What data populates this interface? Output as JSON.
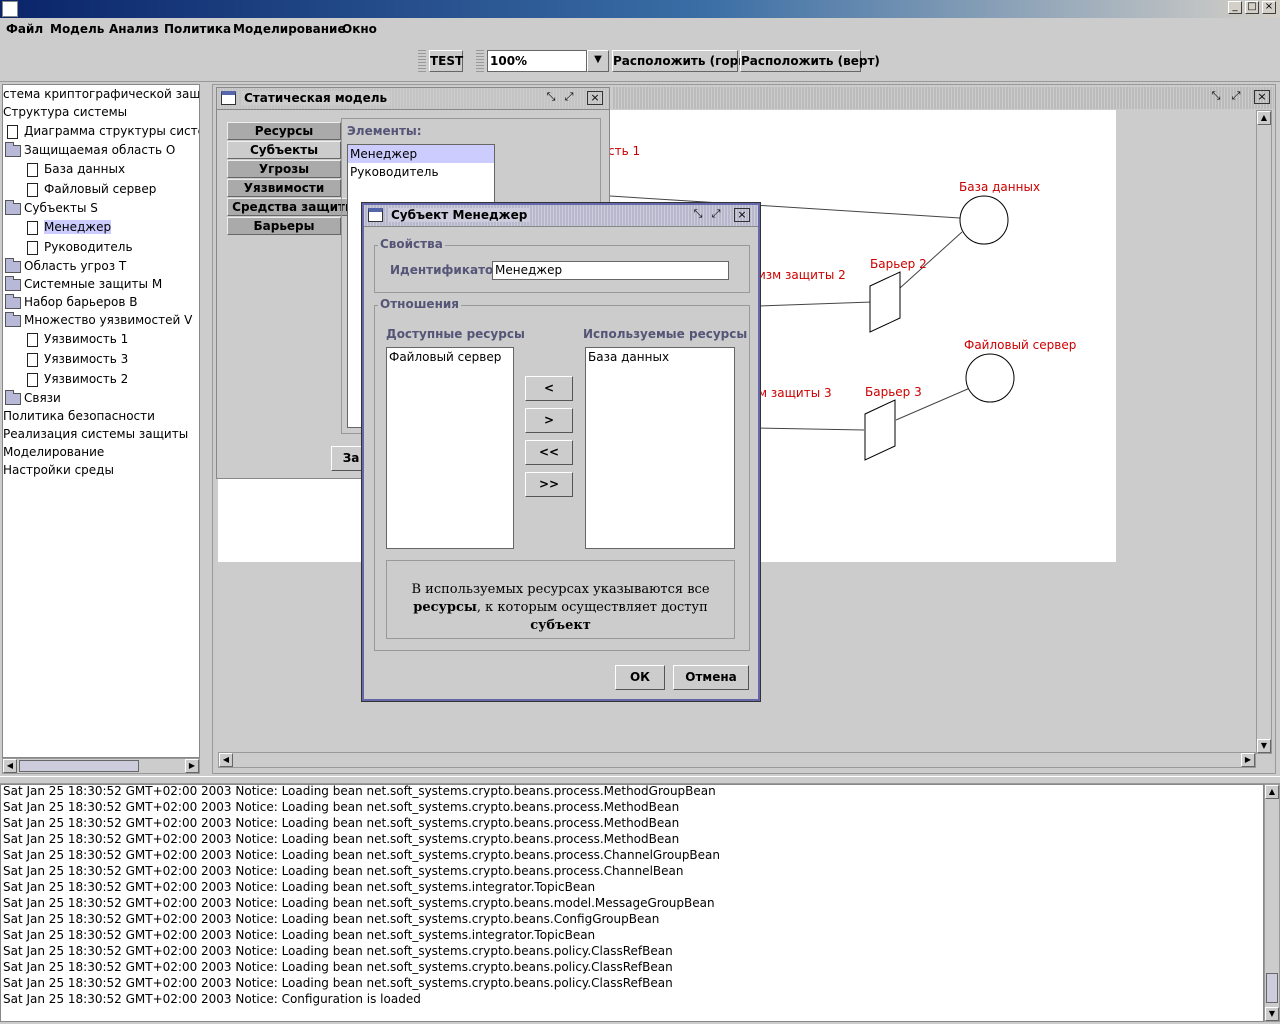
{
  "menu": [
    "Файл",
    "Модель",
    "Анализ",
    "Политика",
    "Моделирование",
    "Окно"
  ],
  "toolbar": {
    "test_label": "TEST",
    "zoom_value": "100%",
    "arrange_h_label": "Расположить (гориз)",
    "arrange_v_label": "Расположить (верт)"
  },
  "tree": [
    "стема криптографической защиты",
    "Структура системы",
    "Диаграмма структуры системы",
    "Защищаемая область O",
    "База данных",
    "Файловый сервер",
    "Субъекты S",
    "Менеджер",
    "Руководитель",
    "Область угроз T",
    "Системные защиты M",
    "Набор барьеров B",
    "Множество уязвимостей V",
    "Уязвимость 1",
    "Уязвимость 3",
    "Уязвимость 2",
    "Связи",
    "Политика безопасности",
    "Реализация системы защиты",
    "Моделирование",
    "Настройки среды"
  ],
  "static_model": {
    "title": "Статическая модель",
    "tabs": [
      "Ресурсы",
      "Субъекты",
      "Угрозы",
      "Уязвимости",
      "Средства защиты",
      "Барьеры"
    ],
    "elements_label": "Элементы:",
    "elements": [
      "Менеджер",
      "Руководитель"
    ],
    "partial_button": "За"
  },
  "diagram": {
    "labels": {
      "area1": "сть 1",
      "db": "База данных",
      "mech2": "изм защиты 2",
      "barrier2": "Барьер 2",
      "fileserver": "Файловый сервер",
      "mech3": "м защиты 3",
      "barrier3": "Барьер 3"
    }
  },
  "dialog": {
    "title": "Субъект Менеджер",
    "props_legend": "Свойства",
    "id_label": "Идентификатор:",
    "id_value": "Менеджер",
    "rel_legend": "Отношения",
    "available_label": "Доступные ресурсы",
    "used_label": "Используемые ресурсы",
    "available": [
      "Файловый сервер"
    ],
    "used": [
      "База данных"
    ],
    "btn_lt": "<",
    "btn_gt": ">",
    "btn_llt": "<<",
    "btn_ggt": ">>",
    "hint_a": "В используемых ресурсах указываются все ",
    "hint_b": "ресурсы",
    "hint_c": ", к которым осуществляет доступ ",
    "hint_d": "субъект",
    "ok": "ОК",
    "cancel": "Отмена"
  },
  "log": [
    "Sat Jan 25 18:30:52 GMT+02:00 2003 Notice: Loading bean net.soft_systems.crypto.beans.process.MethodGroupBean",
    "Sat Jan 25 18:30:52 GMT+02:00 2003 Notice: Loading bean net.soft_systems.crypto.beans.process.MethodBean",
    "Sat Jan 25 18:30:52 GMT+02:00 2003 Notice: Loading bean net.soft_systems.crypto.beans.process.MethodBean",
    "Sat Jan 25 18:30:52 GMT+02:00 2003 Notice: Loading bean net.soft_systems.crypto.beans.process.MethodBean",
    "Sat Jan 25 18:30:52 GMT+02:00 2003 Notice: Loading bean net.soft_systems.crypto.beans.process.ChannelGroupBean",
    "Sat Jan 25 18:30:52 GMT+02:00 2003 Notice: Loading bean net.soft_systems.crypto.beans.process.ChannelBean",
    "Sat Jan 25 18:30:52 GMT+02:00 2003 Notice: Loading bean net.soft_systems.integrator.TopicBean",
    "Sat Jan 25 18:30:52 GMT+02:00 2003 Notice: Loading bean net.soft_systems.crypto.beans.model.MessageGroupBean",
    "Sat Jan 25 18:30:52 GMT+02:00 2003 Notice: Loading bean net.soft_systems.crypto.beans.ConfigGroupBean",
    "Sat Jan 25 18:30:52 GMT+02:00 2003 Notice: Loading bean net.soft_systems.integrator.TopicBean",
    "Sat Jan 25 18:30:52 GMT+02:00 2003 Notice: Loading bean net.soft_systems.crypto.beans.policy.ClassRefBean",
    "Sat Jan 25 18:30:52 GMT+02:00 2003 Notice: Loading bean net.soft_systems.crypto.beans.policy.ClassRefBean",
    "Sat Jan 25 18:30:52 GMT+02:00 2003 Notice: Loading bean net.soft_systems.crypto.beans.policy.ClassRefBean",
    "Sat Jan 25 18:30:52 GMT+02:00 2003 Notice: Configuration is loaded"
  ]
}
